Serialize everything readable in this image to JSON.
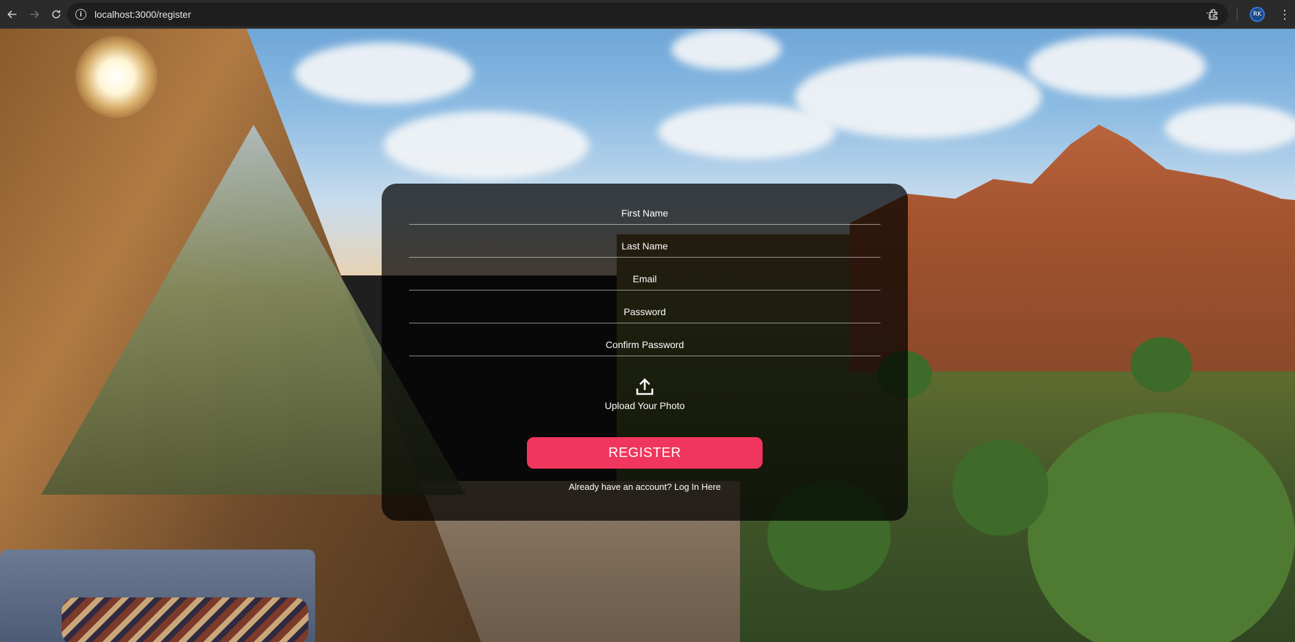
{
  "browser": {
    "url": "localhost:3000/register",
    "back_icon": "arrow-left-icon",
    "forward_icon": "arrow-right-icon",
    "reload_icon": "reload-icon",
    "info_icon": "info-icon",
    "bookmark_icon": "star-icon",
    "extensions_icon": "puzzle-icon",
    "profile_initials": "RK",
    "menu_icon": "kebab-icon"
  },
  "form": {
    "fields": [
      {
        "placeholder": "First Name"
      },
      {
        "placeholder": "Last Name"
      },
      {
        "placeholder": "Email"
      },
      {
        "placeholder": "Password"
      },
      {
        "placeholder": "Confirm Password"
      }
    ],
    "upload_label": "Upload Your Photo",
    "register_label": "REGISTER",
    "login_text": "Already have an account? Log In Here"
  },
  "colors": {
    "accent": "#f0365c",
    "card_overlay": "rgba(0,0,0,0.72)"
  }
}
